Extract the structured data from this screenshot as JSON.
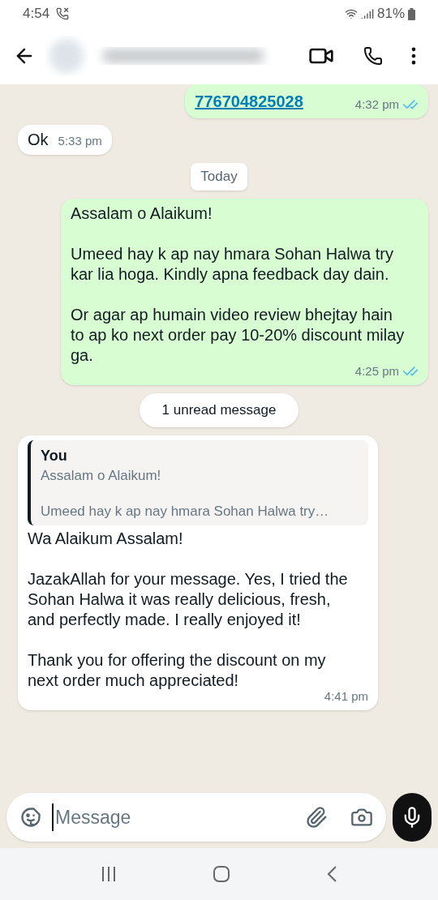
{
  "status_bar": {
    "time": "4:54",
    "battery": "81%"
  },
  "messages": [
    {
      "kind": "outgoing",
      "link": "776704825028",
      "time": "4:32 pm",
      "read": true
    },
    {
      "kind": "incoming",
      "text": "Ok",
      "time": "5:33 pm"
    },
    {
      "kind": "date",
      "text": "Today"
    },
    {
      "kind": "outgoing",
      "text": "Assalam o Alaikum!\n\nUmeed hay k ap nay hmara Sohan Halwa try kar lia hoga. Kindly apna feedback day dain.\n\nOr agar ap humain video review bhejtay hain to ap ko next order pay 10-20% discount milay ga.",
      "time": "4:25 pm",
      "read": true
    },
    {
      "kind": "unread",
      "text": "1 unread message"
    },
    {
      "kind": "incoming",
      "quote": {
        "author": "You",
        "text": "Assalam o Alaikum!\n\nUmeed hay k ap nay hmara Sohan Halwa try…"
      },
      "text": "Wa Alaikum Assalam!\n\nJazakAllah for your message. Yes, I tried the Sohan Halwa it was really delicious, fresh, and perfectly made. I really enjoyed it!\n\nThank you for offering the discount on my next order much appreciated!",
      "time": "4:41 pm"
    }
  ],
  "composer": {
    "placeholder": "Message"
  }
}
